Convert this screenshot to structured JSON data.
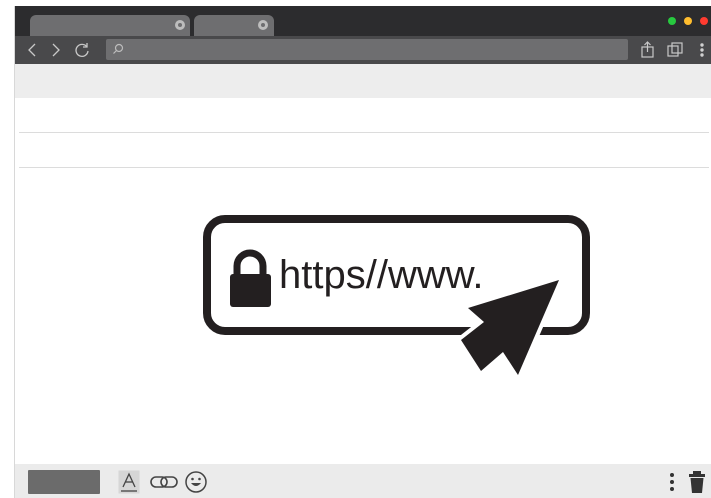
{
  "browser": {
    "tabs": [
      {
        "icon": "close-icon"
      },
      {
        "icon": "close-icon"
      }
    ],
    "window_controls": [
      "green-dot",
      "yellow-dot",
      "red-dot"
    ],
    "toolbar": {
      "back_icon": "chevron-left-icon",
      "forward_icon": "chevron-right-icon",
      "reload_icon": "reload-icon",
      "search_icon": "search-icon",
      "share_icon": "share-icon",
      "tabs_icon": "tabs-icon",
      "menu_icon": "kebab-menu-icon"
    }
  },
  "illustration": {
    "url_text": "https//www.",
    "lock_icon": "padlock-icon",
    "cursor_icon": "arrow-cursor-icon"
  },
  "bottom_bar": {
    "icons": [
      "text-format-icon",
      "link-icon",
      "emoji-icon",
      "kebab-menu-icon",
      "trash-icon"
    ]
  },
  "colors": {
    "titlebar": "#2c2c2e",
    "toolbar": "#49494b",
    "tab": "#6e6e70",
    "illustration": "#231f20",
    "status_light_green": "#27c93f",
    "status_light_yellow": "#ffbd2e",
    "status_light_red": "#ff3b30"
  }
}
